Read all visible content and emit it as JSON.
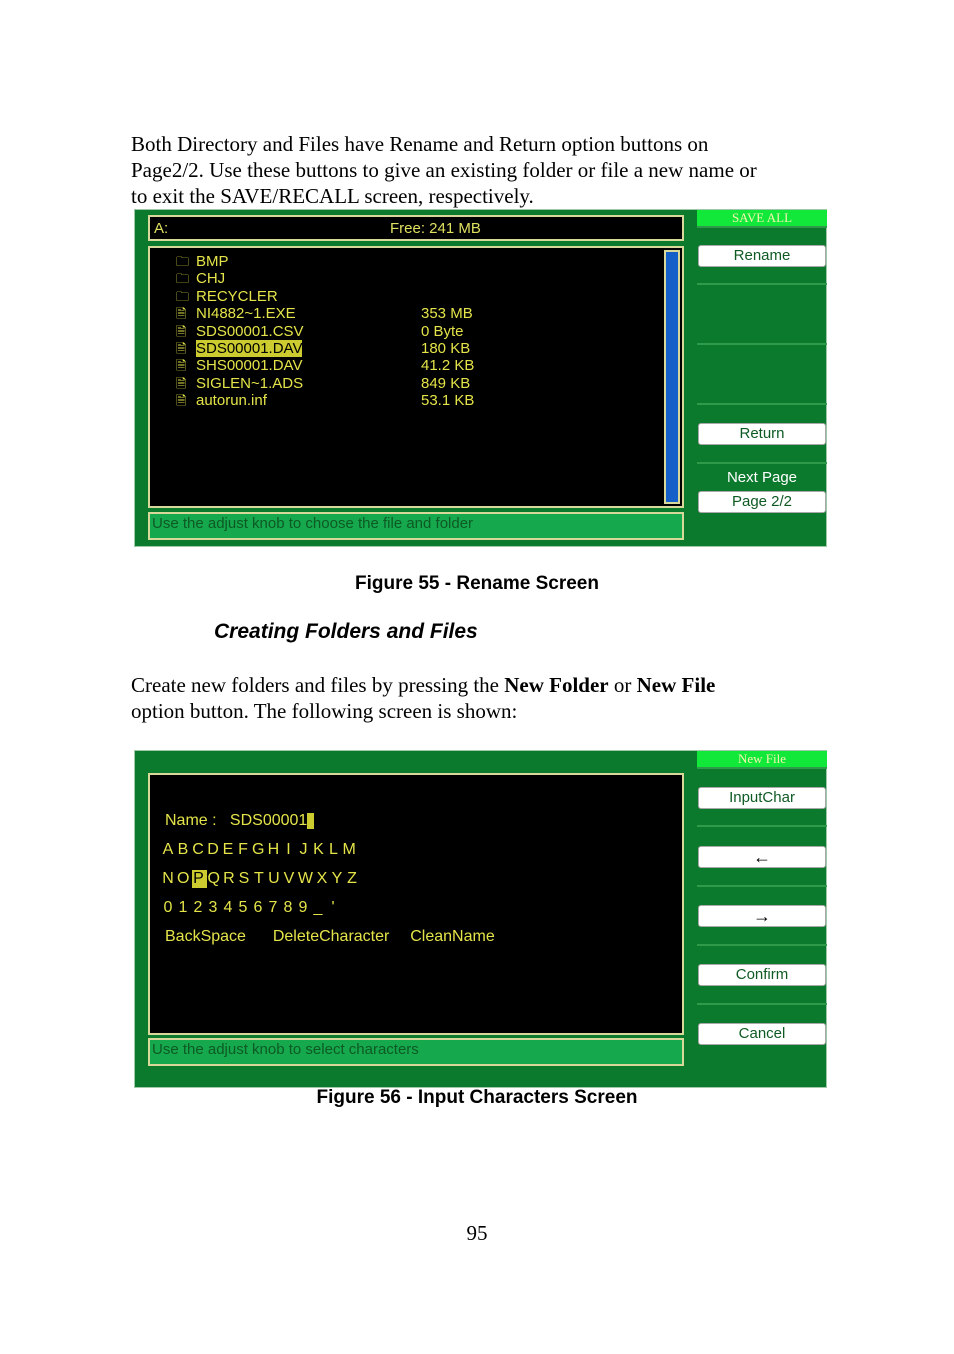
{
  "intro_paragraph": [
    "Both Directory and Files have Rename and Return option buttons on",
    "Page2/2. Use these buttons to give an existing folder or file a new name or",
    "to exit the SAVE/RECALL screen, respectively."
  ],
  "fig55": {
    "drive": "A:",
    "free": "Free: 241 MB",
    "files": [
      {
        "icon": "folder-icon",
        "name": "BMP",
        "size": "",
        "selected": false
      },
      {
        "icon": "folder-icon",
        "name": "CHJ",
        "size": "",
        "selected": false
      },
      {
        "icon": "folder-icon",
        "name": "RECYCLER",
        "size": "",
        "selected": false
      },
      {
        "icon": "file-icon",
        "name": "NI4882~1.EXE",
        "size": "353 MB",
        "selected": false
      },
      {
        "icon": "file-icon",
        "name": "SDS00001.CSV",
        "size": "0 Byte",
        "selected": false
      },
      {
        "icon": "file-icon",
        "name": "SDS00001.DAV",
        "size": "180 KB",
        "selected": true
      },
      {
        "icon": "file-icon",
        "name": "SHS00001.DAV",
        "size": "41.2 KB",
        "selected": false
      },
      {
        "icon": "file-icon",
        "name": "SIGLEN~1.ADS",
        "size": "849 KB",
        "selected": false
      },
      {
        "icon": "file-icon",
        "name": "autorun.inf",
        "size": "53.1 KB",
        "selected": false
      }
    ],
    "status": "Use the adjust knob to choose the file and folder",
    "menu_title": "SAVE ALL",
    "rename": "Rename",
    "return": "Return",
    "next_page": "Next Page",
    "page": "Page 2/2",
    "caption": "Figure 55 - Rename Screen"
  },
  "heading": "Creating Folders and Files",
  "para2": {
    "a": "Create new folders and files by pressing the ",
    "b1": "New Folder",
    "c": " or ",
    "b2": "New File",
    "d": "option button.  The following screen is shown:"
  },
  "fig56": {
    "name_label": "Name :",
    "name_value": "SDS00001",
    "row1": [
      "A",
      "B",
      "C",
      "D",
      "E",
      "F",
      "G",
      "H",
      "I",
      "J",
      "K",
      "L",
      "M"
    ],
    "row2": [
      "N",
      "O",
      "P",
      "Q",
      "R",
      "S",
      "T",
      "U",
      "V",
      "W",
      "X",
      "Y",
      "Z"
    ],
    "row2_selected": "P",
    "row3": [
      "0",
      "1",
      "2",
      "3",
      "4",
      "5",
      "6",
      "7",
      "8",
      "9",
      "_",
      "'"
    ],
    "backspace": "BackSpace",
    "delete_char": "DeleteCharacter",
    "clean_name": "CleanName",
    "status": "Use the adjust knob to select characters",
    "menu_title": "New File",
    "input_char": "InputChar",
    "left_arrow": "←",
    "right_arrow": "→",
    "confirm": "Confirm",
    "cancel": "Cancel",
    "caption": "Figure 56 - Input Characters Screen"
  },
  "page_number": "95"
}
